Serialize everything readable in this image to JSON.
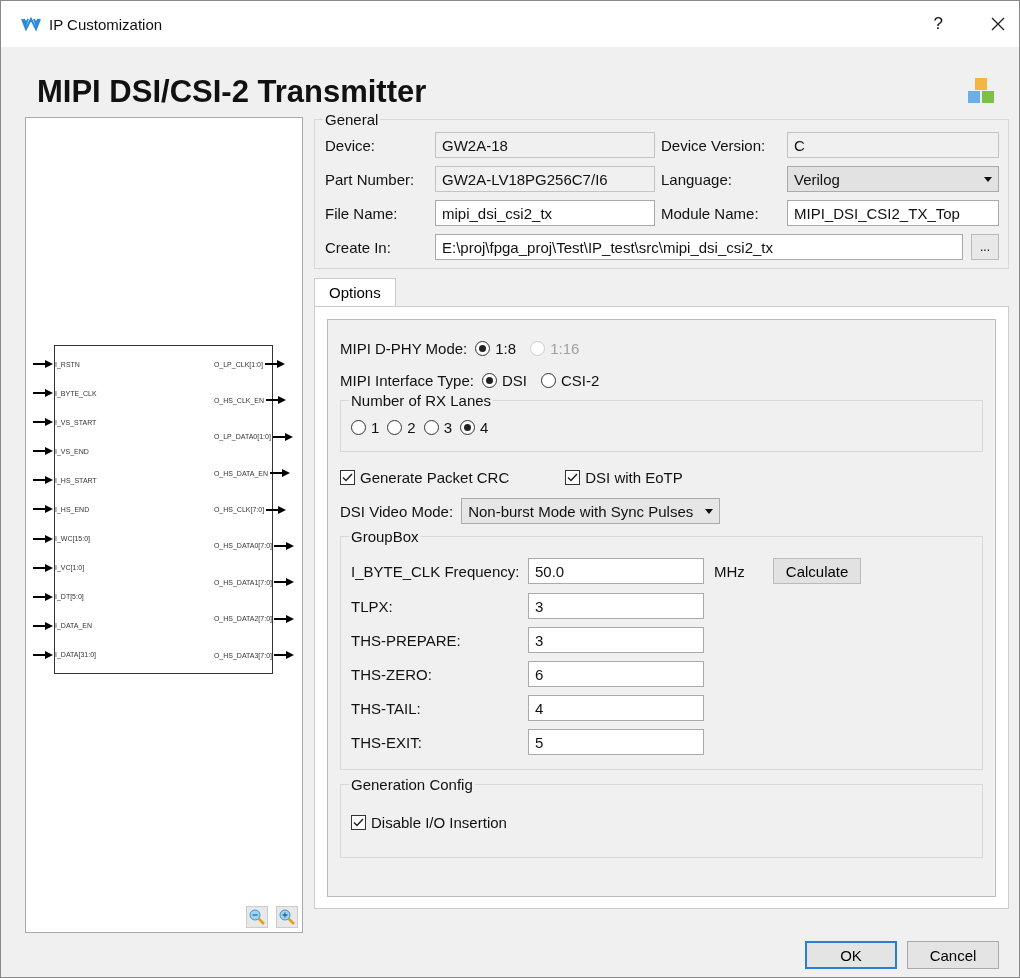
{
  "window": {
    "title": "IP Customization",
    "help": "?"
  },
  "heading": "MIPI DSI/CSI-2 Transmitter",
  "diagram": {
    "inputs": [
      "I_RSTN",
      "I_BYTE_CLK",
      "I_VS_START",
      "I_VS_END",
      "I_HS_START",
      "I_HS_END",
      "I_WC[15:0]",
      "I_VC[1:0]",
      "I_DT[5:0]",
      "I_DATA_EN",
      "I_DATA[31:0]"
    ],
    "outputs": [
      "O_LP_CLK[1:0]",
      "O_HS_CLK_EN",
      "O_LP_DATA0[1:0]",
      "O_HS_DATA_EN",
      "O_HS_CLK[7:0]",
      "O_HS_DATA0[7:0]",
      "O_HS_DATA1[7:0]",
      "O_HS_DATA2[7:0]",
      "O_HS_DATA3[7:0]"
    ]
  },
  "general": {
    "title": "General",
    "fields": [
      {
        "label": "Device:",
        "value": "GW2A-18",
        "kind": "readonly"
      },
      {
        "label": "Device Version:",
        "value": "C",
        "kind": "readonly"
      },
      {
        "label": "Part Number:",
        "value": "GW2A-LV18PG256C7/I6",
        "kind": "readonly"
      },
      {
        "label": "Language:",
        "value": "Verilog",
        "kind": "select"
      },
      {
        "label": "File Name:",
        "value": "mipi_dsi_csi2_tx",
        "kind": "input"
      },
      {
        "label": "Module Name:",
        "value": "MIPI_DSI_CSI2_TX_Top",
        "kind": "input"
      }
    ],
    "create_in": {
      "label": "Create In:",
      "value": "E:\\proj\\fpga_proj\\Test\\IP_test\\src\\mipi_dsi_csi2_tx",
      "browse": "..."
    }
  },
  "tabs": [
    {
      "label": "Options",
      "selected": true
    }
  ],
  "dphy_mode": {
    "label": "MIPI D-PHY Mode:",
    "options": [
      {
        "label": "1:8",
        "selected": true,
        "disabled": false
      },
      {
        "label": "1:16",
        "selected": false,
        "disabled": true
      }
    ]
  },
  "interface_type": {
    "label": "MIPI Interface Type:",
    "options": [
      {
        "label": "DSI",
        "selected": true,
        "disabled": false
      },
      {
        "label": "CSI-2",
        "selected": false,
        "disabled": false
      }
    ]
  },
  "rx_lanes": {
    "title": "Number of RX Lanes",
    "options": [
      {
        "label": "1",
        "selected": false,
        "disabled": false
      },
      {
        "label": "2",
        "selected": false,
        "disabled": false
      },
      {
        "label": "3",
        "selected": false,
        "disabled": false
      },
      {
        "label": "4",
        "selected": true,
        "disabled": false
      }
    ]
  },
  "checkboxes": [
    {
      "label": "Generate Packet CRC",
      "checked": true
    },
    {
      "label": "DSI with EoTP",
      "checked": true
    }
  ],
  "video_mode": {
    "label": "DSI Video Mode:",
    "value": "Non-burst Mode with Sync Pulses"
  },
  "groupbox": {
    "title": "GroupBox",
    "frequency": {
      "label": "I_BYTE_CLK Frequency:",
      "value": "50.0",
      "unit": "MHz"
    },
    "calculate": "Calculate",
    "params": [
      {
        "label": "TLPX:",
        "value": "3"
      },
      {
        "label": "THS-PREPARE:",
        "value": "3"
      },
      {
        "label": "THS-ZERO:",
        "value": "6"
      },
      {
        "label": "THS-TAIL:",
        "value": "4"
      },
      {
        "label": "THS-EXIT:",
        "value": "5"
      }
    ]
  },
  "generation": {
    "title": "Generation Config",
    "checkbox": {
      "label": "Disable I/O Insertion",
      "checked": true
    }
  },
  "buttons": [
    {
      "label": "OK",
      "default": true
    },
    {
      "label": "Cancel",
      "default": false
    }
  ]
}
